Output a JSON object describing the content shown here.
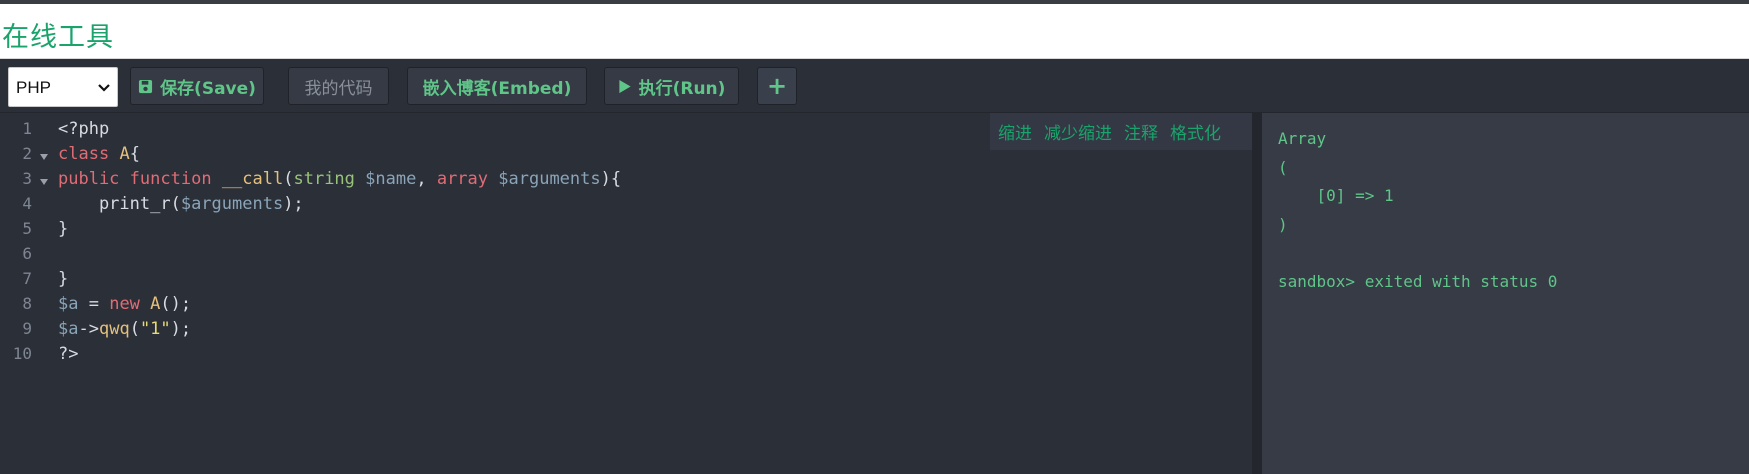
{
  "header": {
    "title": "在线工具"
  },
  "toolbar": {
    "language": "PHP",
    "save_label": "保存(Save)",
    "my_code_label": "我的代码",
    "embed_label": "嵌入博客(Embed)",
    "run_label": "执行(Run)",
    "add_label": "+"
  },
  "editor": {
    "actions": [
      "缩进",
      "减少缩进",
      "注释",
      "格式化"
    ],
    "line_numbers": [
      "1",
      "2",
      "3",
      "4",
      "5",
      "6",
      "7",
      "8",
      "9",
      "10"
    ],
    "lines": [
      [
        {
          "t": "<?php",
          "c": ""
        }
      ],
      [
        {
          "t": "class",
          "c": "kw"
        },
        {
          "t": " ",
          "c": ""
        },
        {
          "t": "A",
          "c": "cls2"
        },
        {
          "t": "{",
          "c": ""
        }
      ],
      [
        {
          "t": "public",
          "c": "kw"
        },
        {
          "t": " ",
          "c": ""
        },
        {
          "t": "function",
          "c": "kw"
        },
        {
          "t": " ",
          "c": ""
        },
        {
          "t": "__call",
          "c": "fn"
        },
        {
          "t": "(",
          "c": ""
        },
        {
          "t": "string",
          "c": "ty"
        },
        {
          "t": " ",
          "c": ""
        },
        {
          "t": "$name",
          "c": "var"
        },
        {
          "t": ", ",
          "c": ""
        },
        {
          "t": "array",
          "c": "kw"
        },
        {
          "t": " ",
          "c": ""
        },
        {
          "t": "$arguments",
          "c": "var"
        },
        {
          "t": "){",
          "c": ""
        }
      ],
      [
        {
          "t": "    print_r(",
          "c": ""
        },
        {
          "t": "$arguments",
          "c": "var"
        },
        {
          "t": ");",
          "c": ""
        }
      ],
      [
        {
          "t": "}",
          "c": ""
        }
      ],
      [
        {
          "t": "",
          "c": ""
        }
      ],
      [
        {
          "t": "}",
          "c": ""
        }
      ],
      [
        {
          "t": "$a",
          "c": "var"
        },
        {
          "t": " = ",
          "c": ""
        },
        {
          "t": "new",
          "c": "kw"
        },
        {
          "t": " ",
          "c": ""
        },
        {
          "t": "A",
          "c": "cls2"
        },
        {
          "t": "();",
          "c": ""
        }
      ],
      [
        {
          "t": "$a",
          "c": "var"
        },
        {
          "t": "->",
          "c": ""
        },
        {
          "t": "qwq",
          "c": "fn"
        },
        {
          "t": "(",
          "c": ""
        },
        {
          "t": "\"1\"",
          "c": "str"
        },
        {
          "t": ");",
          "c": ""
        }
      ],
      [
        {
          "t": "?>",
          "c": ""
        }
      ]
    ]
  },
  "output": {
    "lines": [
      "Array",
      "(",
      "    [0] => 1",
      ")",
      "",
      "sandbox> exited with status 0"
    ]
  },
  "colors": {
    "accent": "#1aa36b",
    "output_text": "#5fc589"
  }
}
